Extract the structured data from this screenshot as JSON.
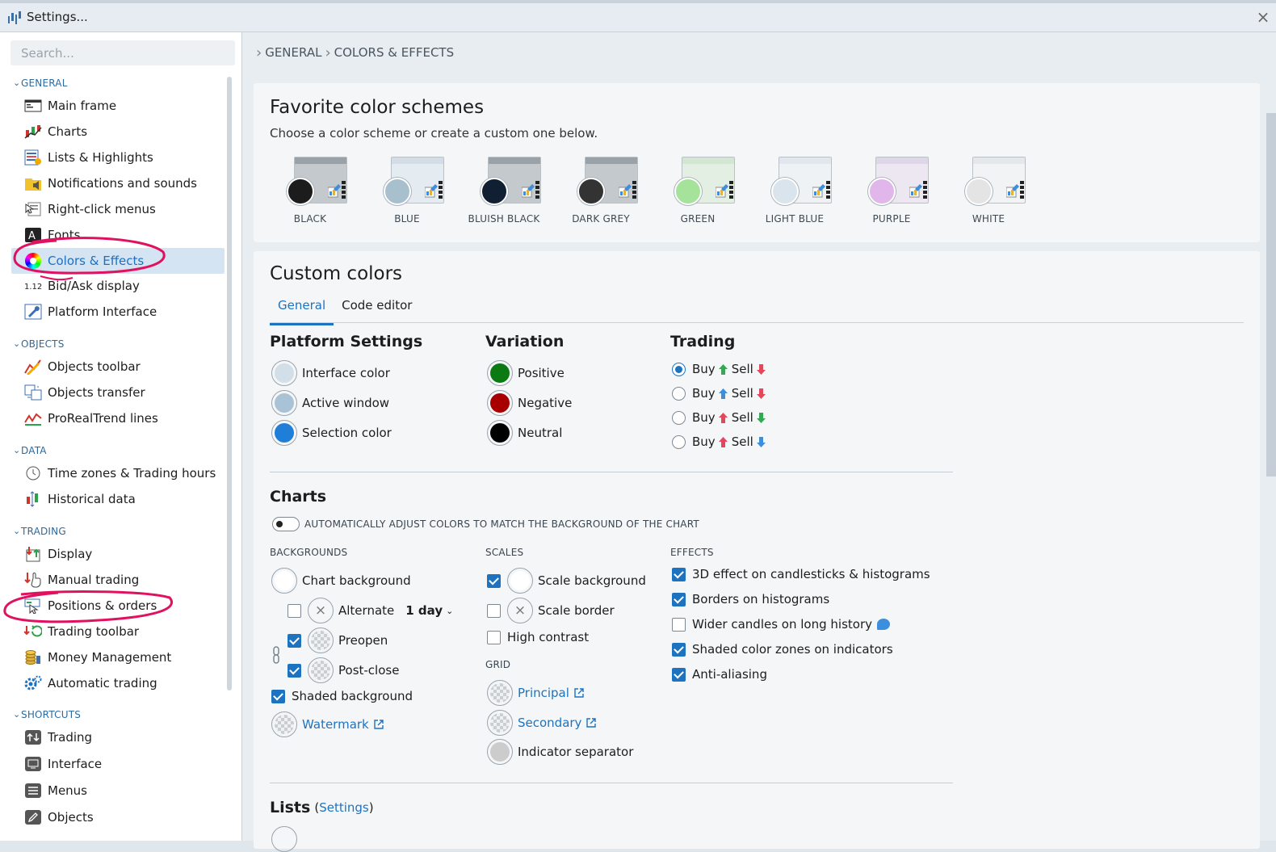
{
  "window": {
    "title": "Settings..."
  },
  "search": {
    "placeholder": "Search..."
  },
  "sidebar": {
    "sections": [
      {
        "label": "GENERAL"
      },
      {
        "label": "OBJECTS"
      },
      {
        "label": "DATA"
      },
      {
        "label": "TRADING"
      },
      {
        "label": "SHORTCUTS"
      }
    ],
    "items": [
      {
        "label": "Main frame",
        "icon": "main-frame-icon"
      },
      {
        "label": "Charts",
        "icon": "charts-icon"
      },
      {
        "label": "Lists & Highlights",
        "icon": "lists-icon"
      },
      {
        "label": "Notifications and sounds",
        "icon": "notifications-icon"
      },
      {
        "label": "Right-click menus",
        "icon": "right-click-icon"
      },
      {
        "label": "Fonts",
        "icon": "fonts-icon"
      },
      {
        "label": "Colors & Effects",
        "icon": "color-wheel-icon",
        "selected": true
      },
      {
        "label": "Bid/Ask display",
        "icon": "bid-ask-icon"
      },
      {
        "label": "Platform Interface",
        "icon": "wrench-icon"
      },
      {
        "label": "Objects toolbar",
        "icon": "objects-toolbar-icon"
      },
      {
        "label": "Objects transfer",
        "icon": "objects-transfer-icon"
      },
      {
        "label": "ProRealTrend lines",
        "icon": "trend-lines-icon"
      },
      {
        "label": "Time zones & Trading hours",
        "icon": "clock-icon"
      },
      {
        "label": "Historical data",
        "icon": "historical-data-icon"
      },
      {
        "label": "Display",
        "icon": "display-icon"
      },
      {
        "label": "Manual trading",
        "icon": "manual-trading-icon"
      },
      {
        "label": "Positions & orders",
        "icon": "positions-icon"
      },
      {
        "label": "Trading toolbar",
        "icon": "trading-toolbar-icon"
      },
      {
        "label": "Money Management",
        "icon": "money-icon"
      },
      {
        "label": "Automatic trading",
        "icon": "gears-icon"
      },
      {
        "label": "Trading",
        "icon": "trading-shortcut-icon"
      },
      {
        "label": "Interface",
        "icon": "monitor-icon"
      },
      {
        "label": "Menus",
        "icon": "menu-icon"
      },
      {
        "label": "Objects",
        "icon": "pencil-icon"
      }
    ]
  },
  "breadcrumb": [
    "GENERAL",
    "COLORS & EFFECTS"
  ],
  "favorites": {
    "title": "Favorite color schemes",
    "subtitle": "Choose a color scheme or create a custom one below.",
    "schemes": [
      {
        "label": "BLACK",
        "bg": "#c4c9cd",
        "bar": "#9aa1a7",
        "dot": "#1c1c1c"
      },
      {
        "label": "BLUE",
        "bg": "#e4ebf1",
        "bar": "#d4dde5",
        "dot": "#a8bfce"
      },
      {
        "label": "BLUISH BLACK",
        "bg": "#c4c9cd",
        "bar": "#9aa1a7",
        "dot": "#102032"
      },
      {
        "label": "DARK GREY",
        "bg": "#c4c9cd",
        "bar": "#9aa1a7",
        "dot": "#333333"
      },
      {
        "label": "GREEN",
        "bg": "#e3efe2",
        "bar": "#d3e6d2",
        "dot": "#a6e39a"
      },
      {
        "label": "LIGHT BLUE",
        "bg": "#eef2f5",
        "bar": "#e1e7ec",
        "dot": "#d9e4ec"
      },
      {
        "label": "PURPLE",
        "bg": "#ece7f1",
        "bar": "#dfd7e8",
        "dot": "#e1b6ea"
      },
      {
        "label": "WHITE",
        "bg": "#f1f3f5",
        "bar": "#e5e8eb",
        "dot": "#e4e4e4"
      }
    ]
  },
  "custom": {
    "title": "Custom colors",
    "tabs": [
      "General",
      "Code editor"
    ],
    "platform": {
      "title": "Platform Settings",
      "rows": [
        {
          "label": "Interface color",
          "color": "#d3dfe8"
        },
        {
          "label": "Active window",
          "color": "#a9c2d6"
        },
        {
          "label": "Selection color",
          "color": "#1f7fd8"
        }
      ]
    },
    "variation": {
      "title": "Variation",
      "rows": [
        {
          "label": "Positive",
          "color": "#0b7a12"
        },
        {
          "label": "Negative",
          "color": "#a80000"
        },
        {
          "label": "Neutral",
          "color": "#000000"
        }
      ]
    },
    "trading": {
      "title": "Trading",
      "buy": "Buy",
      "sell": "Sell",
      "options": [
        {
          "selected": true,
          "buy_color": "#34a853",
          "sell_color": "#e2475c"
        },
        {
          "selected": false,
          "buy_color": "#3c8fdc",
          "sell_color": "#e2475c"
        },
        {
          "selected": false,
          "buy_color": "#e2475c",
          "sell_color": "#34a853"
        },
        {
          "selected": false,
          "buy_color": "#e2475c",
          "sell_color": "#3c8fdc"
        }
      ]
    },
    "charts": {
      "title": "Charts",
      "auto_adjust": "AUTOMATICALLY ADJUST COLORS TO MATCH THE BACKGROUND OF THE CHART",
      "backgrounds": {
        "caption": "BACKGROUNDS",
        "chart_background": "Chart background",
        "alternate": "Alternate",
        "alternate_value": "1 day",
        "preopen": "Preopen",
        "post_close": "Post-close",
        "shaded": "Shaded background",
        "watermark": "Watermark"
      },
      "scales": {
        "caption": "SCALES",
        "scale_background": "Scale background",
        "scale_border": "Scale border",
        "high_contrast": "High contrast"
      },
      "grid": {
        "caption": "GRID",
        "principal": "Principal",
        "secondary": "Secondary",
        "indicator_separator": "Indicator separator"
      },
      "effects": {
        "caption": "EFFECTS",
        "items": [
          {
            "label": "3D effect on candlesticks & histograms",
            "checked": true
          },
          {
            "label": "Borders on histograms",
            "checked": true
          },
          {
            "label": "Wider candles on long history",
            "checked": false
          },
          {
            "label": "Shaded color zones on indicators",
            "checked": true
          },
          {
            "label": "Anti-aliasing",
            "checked": true
          }
        ]
      }
    },
    "lists": {
      "title": "Lists",
      "open": "(",
      "settings": "Settings",
      "close": ")"
    }
  }
}
